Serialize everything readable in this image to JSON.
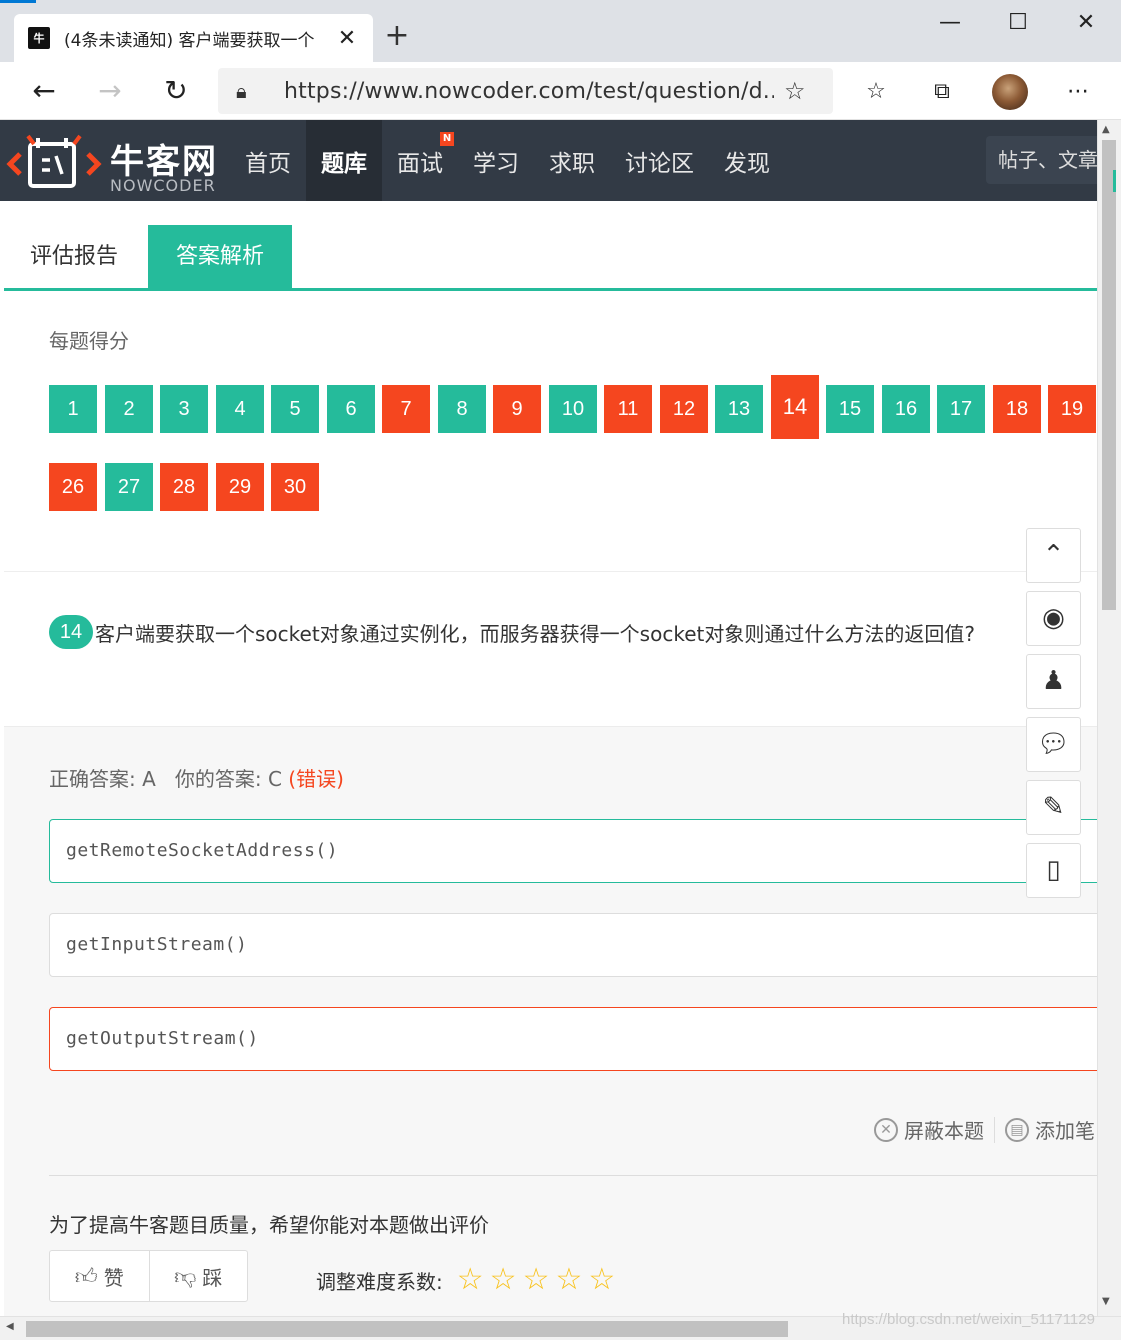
{
  "browser": {
    "tab_title": "(4条未读通知) 客户端要获取一个",
    "favicon_text": "牛",
    "url": "https://www.nowcoder.com/test/question/d...",
    "new_tab": "+",
    "minimize": "—",
    "maximize": "☐",
    "close": "✕",
    "tab_close": "✕"
  },
  "site": {
    "logo_cn": "牛客网",
    "logo_en": "NOWCODER",
    "nav": [
      {
        "label": "首页"
      },
      {
        "label": "题库",
        "active": true
      },
      {
        "label": "面试",
        "badge": "N"
      },
      {
        "label": "学习"
      },
      {
        "label": "求职"
      },
      {
        "label": "讨论区"
      },
      {
        "label": "发现"
      }
    ],
    "search_placeholder": "帖子、文章"
  },
  "tabs": {
    "report": "评估报告",
    "analysis": "答案解析"
  },
  "score": {
    "label": "每题得分",
    "questions": [
      {
        "n": "1",
        "status": "ok"
      },
      {
        "n": "2",
        "status": "ok"
      },
      {
        "n": "3",
        "status": "ok"
      },
      {
        "n": "4",
        "status": "ok"
      },
      {
        "n": "5",
        "status": "ok"
      },
      {
        "n": "6",
        "status": "ok"
      },
      {
        "n": "7",
        "status": "wrong"
      },
      {
        "n": "8",
        "status": "ok"
      },
      {
        "n": "9",
        "status": "wrong"
      },
      {
        "n": "10",
        "status": "ok"
      },
      {
        "n": "11",
        "status": "wrong"
      },
      {
        "n": "12",
        "status": "wrong"
      },
      {
        "n": "13",
        "status": "ok"
      },
      {
        "n": "14",
        "status": "wrong",
        "current": true
      },
      {
        "n": "15",
        "status": "ok"
      },
      {
        "n": "16",
        "status": "ok"
      },
      {
        "n": "17",
        "status": "ok"
      },
      {
        "n": "18",
        "status": "wrong"
      },
      {
        "n": "19",
        "status": "wrong"
      },
      {
        "n": "26",
        "status": "wrong"
      },
      {
        "n": "27",
        "status": "ok"
      },
      {
        "n": "28",
        "status": "wrong"
      },
      {
        "n": "29",
        "status": "wrong"
      },
      {
        "n": "30",
        "status": "wrong"
      }
    ]
  },
  "question": {
    "number": "14",
    "text": "客户端要获取一个socket对象通过实例化，而服务器获得一个socket对象则通过什么方法的返回值?"
  },
  "answer": {
    "correct_label": "正确答案: A",
    "yours_label": "你的答案: C",
    "result": "(错误)",
    "options": [
      {
        "text": "getRemoteSocketAddress()",
        "state": "correct"
      },
      {
        "text": "getInputStream()",
        "state": "normal"
      },
      {
        "text": "getOutputStream()",
        "state": "wrong"
      }
    ]
  },
  "actions": {
    "block": "屏蔽本题",
    "add_note": "添加笔"
  },
  "feedback": {
    "prompt": "为了提高牛客题目质量，希望你能对本题做出评价",
    "like": "赞",
    "dislike": "踩",
    "difficulty_label": "调整难度系数:",
    "stars": 5
  },
  "colors": {
    "green": "#25bb9b",
    "red": "#f5461f",
    "header": "#323a45",
    "star": "#f8c21c"
  },
  "watermark": "https://blog.csdn.net/weixin_51171129"
}
